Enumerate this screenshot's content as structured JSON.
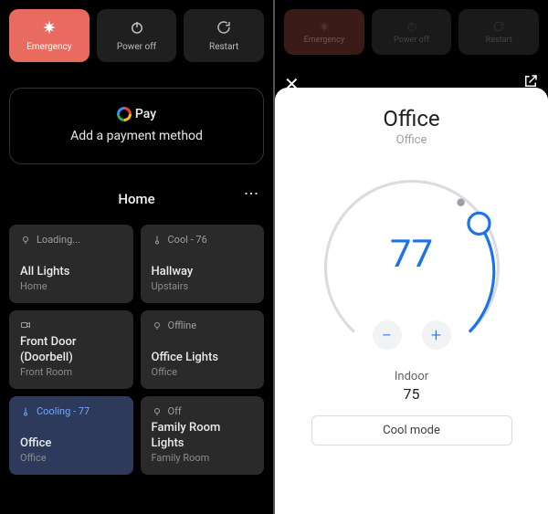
{
  "power_row": {
    "emergency": "Emergency",
    "power_off": "Power off",
    "restart": "Restart"
  },
  "pay": {
    "brand": "Pay",
    "message": "Add a payment method"
  },
  "home": {
    "title": "Home"
  },
  "devices": [
    {
      "status": "Loading...",
      "name": "All Lights",
      "location": "Home",
      "icon": "bulb"
    },
    {
      "status": "Cool - 76",
      "name": "Hallway",
      "location": "Upstairs",
      "icon": "thermo"
    },
    {
      "status": "",
      "name": "Front Door (Doorbell)",
      "location": "Front Room",
      "icon": "camera"
    },
    {
      "status": "Offline",
      "name": "Office Lights",
      "location": "Office",
      "icon": "bulb"
    },
    {
      "status": "Cooling - 77",
      "name": "Office",
      "location": "Office",
      "icon": "thermo",
      "active": true
    },
    {
      "status": "Off",
      "name": "Family Room Lights",
      "location": "Family Room",
      "icon": "bulb"
    }
  ],
  "thermostat": {
    "title": "Office",
    "subtitle": "Office",
    "setpoint": "77",
    "indoor_label": "Indoor",
    "indoor_value": "75",
    "mode": "Cool mode"
  }
}
